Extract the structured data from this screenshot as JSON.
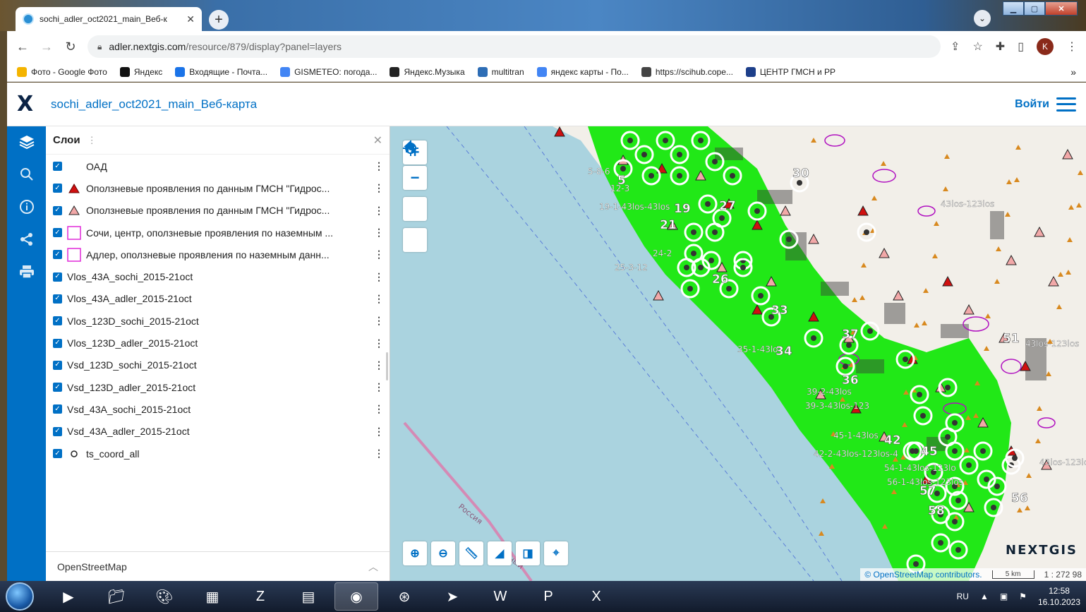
{
  "browser": {
    "tab_title": "sochi_adler_oct2021_main_Веб-к",
    "url_host": "adler.nextgis.com",
    "url_path": "/resource/879/display?panel=layers",
    "profile_initial": "K",
    "bookmarks": [
      {
        "label": "Фото - Google Фото",
        "color": "#f4b400"
      },
      {
        "label": "Яндекс",
        "color": "#111111"
      },
      {
        "label": "Входящие - Почта...",
        "color": "#1a73e8"
      },
      {
        "label": "GISMETEO: погода...",
        "color": "#4285f4"
      },
      {
        "label": "Яндекс.Музыка",
        "color": "#222222"
      },
      {
        "label": "multitran",
        "color": "#2d6db5"
      },
      {
        "label": "яндекс карты - По...",
        "color": "#4285f4"
      },
      {
        "label": "https://scihub.cope...",
        "color": "#444444"
      },
      {
        "label": "ЦЕНТР ГМСН и РР",
        "color": "#1d3f8a"
      }
    ],
    "more_label": "»"
  },
  "app": {
    "title": "sochi_adler_oct2021_main_Веб-карта",
    "login": "Войти",
    "accent": "#0070c5"
  },
  "panel": {
    "title": "Слои",
    "layers": [
      {
        "name": "ОАД",
        "symbol": "none"
      },
      {
        "name": "Оползневые проявления по данным ГМСН \"Гидрос...",
        "symbol": "triangle-red"
      },
      {
        "name": "Оползневые проявления по данным ГМСН \"Гидрос...",
        "symbol": "triangle-pink"
      },
      {
        "name": "Сочи, центр, оползневые проявления по наземным ...",
        "symbol": "square-magenta"
      },
      {
        "name": "Адлер, оползневые проявления по наземным данн...",
        "symbol": "square-magenta"
      },
      {
        "name": "Vlos_43A_sochi_2015-21oct",
        "symbol": "none-compact"
      },
      {
        "name": "Vlos_43A_adler_2015-21oct",
        "symbol": "none-compact"
      },
      {
        "name": "Vlos_123D_sochi_2015-21oct",
        "symbol": "none-compact"
      },
      {
        "name": "Vlos_123D_adler_2015-21oct",
        "symbol": "none-compact"
      },
      {
        "name": "Vsd_123D_sochi_2015-21oct",
        "symbol": "none-compact"
      },
      {
        "name": "Vsd_123D_adler_2015-21oct",
        "symbol": "none-compact"
      },
      {
        "name": "Vsd_43A_sochi_2015-21oct",
        "symbol": "none-compact"
      },
      {
        "name": "Vsd_43A_adler_2015-21oct",
        "symbol": "none-compact"
      },
      {
        "name": "ts_coord_all",
        "symbol": "circle"
      }
    ],
    "basemap": "OpenStreetMap"
  },
  "map": {
    "labels": [
      {
        "text": "5",
        "big": true
      },
      {
        "text": "19",
        "big": true
      },
      {
        "text": "21",
        "big": true
      },
      {
        "text": "26",
        "big": true
      },
      {
        "text": "27",
        "big": true
      },
      {
        "text": "30",
        "big": true
      },
      {
        "text": "33",
        "big": true
      },
      {
        "text": "34",
        "big": true
      },
      {
        "text": "36",
        "big": true
      },
      {
        "text": "37",
        "big": true
      },
      {
        "text": "42",
        "big": true
      },
      {
        "text": "45",
        "big": true
      },
      {
        "text": "51",
        "big": true
      },
      {
        "text": "56",
        "big": true
      },
      {
        "text": "57",
        "big": true
      },
      {
        "text": "58",
        "big": true
      },
      {
        "text": "5-8-6",
        "big": false
      },
      {
        "text": "12-3",
        "big": false
      },
      {
        "text": "19-1-43los-43los",
        "big": false
      },
      {
        "text": "24-2",
        "big": false
      },
      {
        "text": "25-3-12",
        "big": false
      },
      {
        "text": "35-1-43lo",
        "big": false
      },
      {
        "text": "39-2-43los",
        "big": false
      },
      {
        "text": "39-3-43los-123",
        "big": false
      },
      {
        "text": "45-1-43los",
        "big": false
      },
      {
        "text": "42-2-43los-123los-4",
        "big": false
      },
      {
        "text": "54-1-43los-123lo",
        "big": false
      },
      {
        "text": "56-1-43los-123los",
        "big": false
      },
      {
        "text": "43los-123los",
        "big": false
      },
      {
        "text": "43los-123los",
        "big": false
      },
      {
        "text": "43los-123lo",
        "big": false
      }
    ],
    "road_label": "Россия",
    "road_label2": "Южный",
    "logo": "NEXTGIS",
    "attribution": "© OpenStreetMap contributors.",
    "scale_label": "5 km",
    "scale_ratio": "1 : 272 98",
    "colors": {
      "sea": "#aad3df",
      "land": "#f2efe9",
      "vel_green": "#21e817",
      "landslide": "#d8891f",
      "polygon": "#b010c0"
    }
  },
  "taskbar": {
    "lang": "RU",
    "time": "12:58",
    "date": "16.10.2023"
  }
}
